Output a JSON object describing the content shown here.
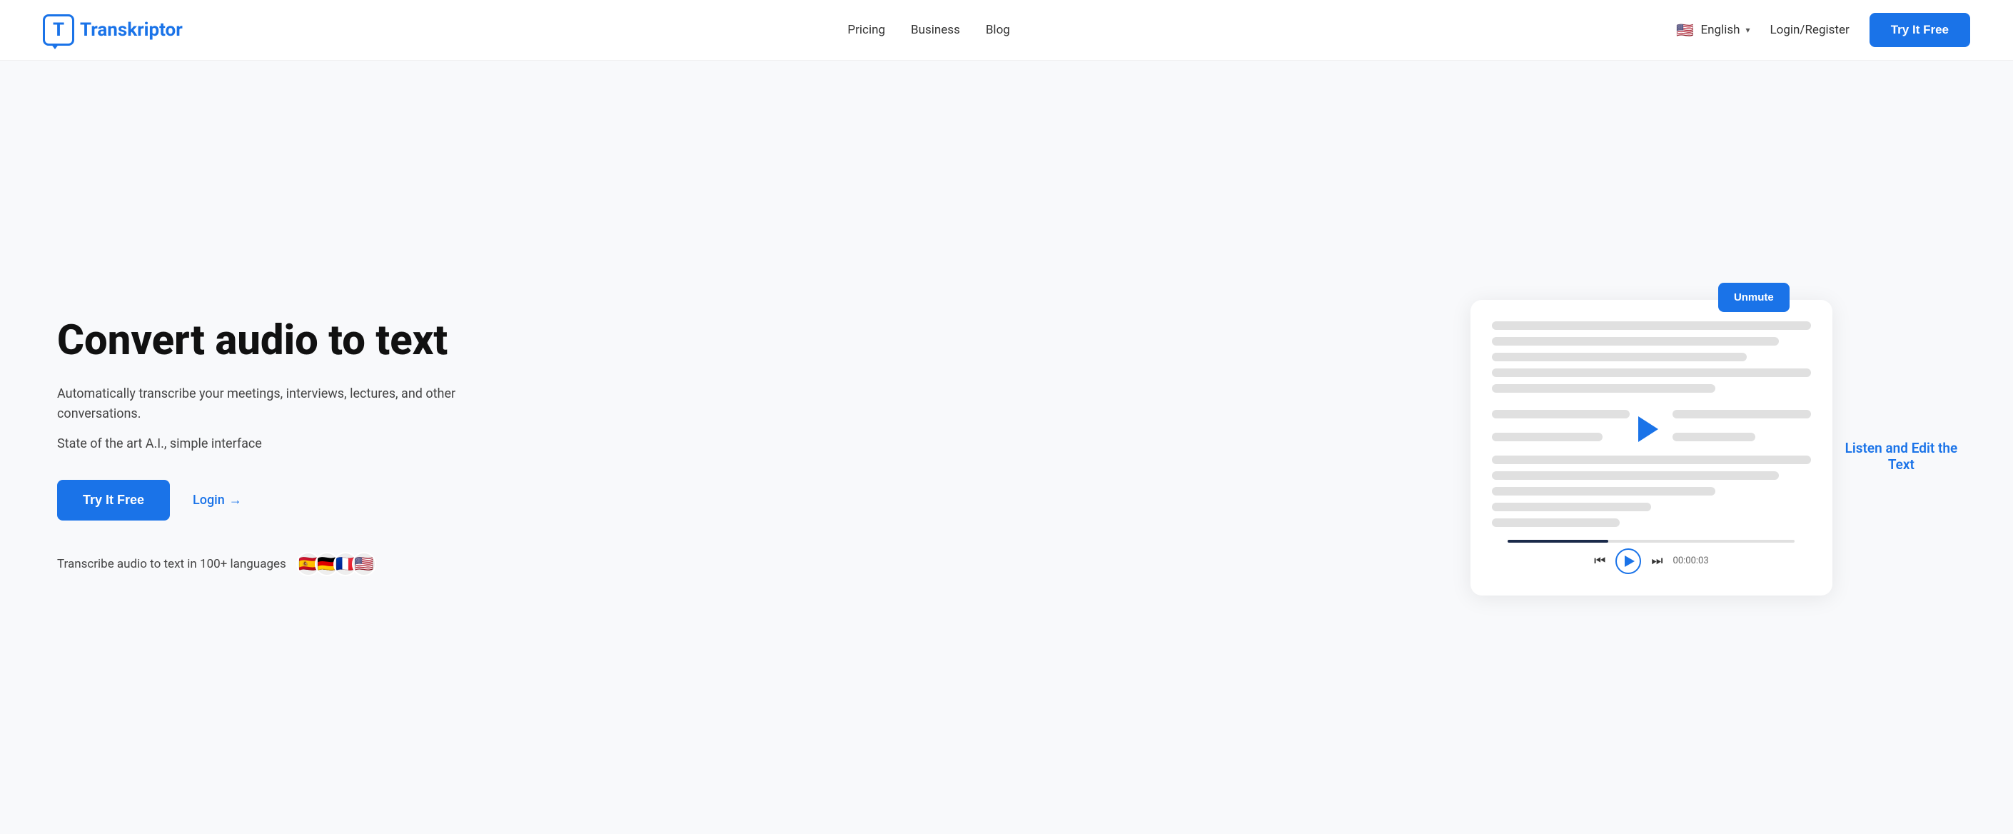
{
  "brand": {
    "name": "Transkriptor",
    "logo_letter": "T"
  },
  "nav": {
    "pricing": "Pricing",
    "business": "Business",
    "blog": "Blog",
    "language": "English",
    "login_register": "Login/Register",
    "try_it_free_header": "Try It Free"
  },
  "hero": {
    "title": "Convert audio to text",
    "description": "Automatically transcribe your meetings, interviews, lectures, and other conversations.",
    "subtitle": "State of the art A.I., simple interface",
    "try_it_free": "Try It Free",
    "login": "Login",
    "login_arrow": "→",
    "languages_label": "Transcribe audio to text in 100+ languages"
  },
  "player": {
    "unmute_label": "Unmute",
    "timestamp": "00:00:03",
    "listen_edit_label": "Listen and Edit the Text"
  },
  "flags": {
    "spanish": "🇪🇸",
    "german": "🇩🇪",
    "french": "🇫🇷",
    "usa": "🇺🇸"
  },
  "colors": {
    "primary": "#1a73e8",
    "text_dark": "#111111",
    "text_mid": "#444444",
    "bg_hero": "#f8f9fb"
  }
}
